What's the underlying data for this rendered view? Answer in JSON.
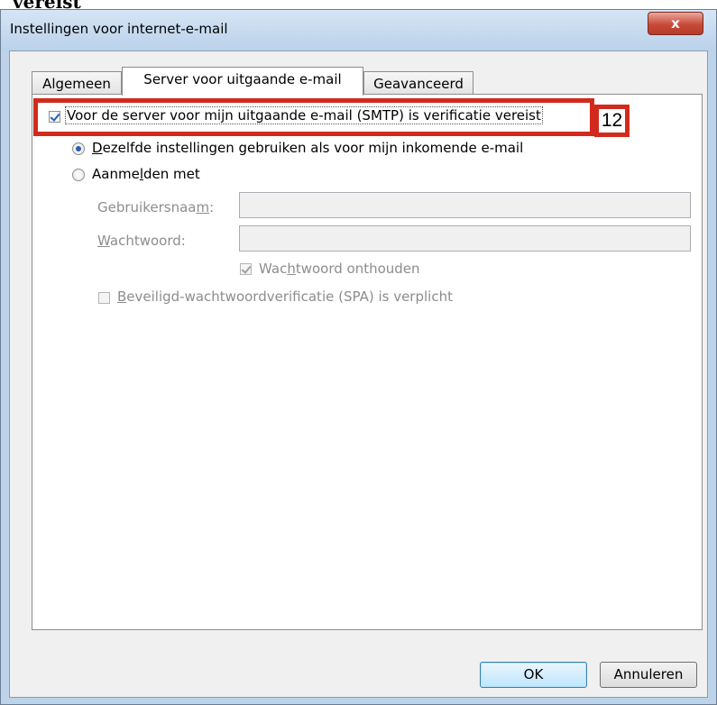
{
  "top_cut_text": "vereist\"",
  "window": {
    "title": "Instellingen voor internet-e-mail",
    "close_label": "x"
  },
  "tabs": [
    {
      "label": "Algemeen",
      "active": false
    },
    {
      "label": "Server voor uitgaande e-mail",
      "active": true
    },
    {
      "label": "Geavanceerd",
      "active": false
    }
  ],
  "smtp": {
    "label": "Voor de server voor mijn uitgaande e-mail (SMTP) is verificatie vereist",
    "checked": true,
    "annotation": "12"
  },
  "radio_same": {
    "pre": "",
    "accel": "D",
    "post": "ezelfde instellingen gebruiken als voor mijn inkomende e-mail",
    "checked": true
  },
  "radio_login": {
    "pre": "Aanme",
    "accel": "l",
    "post": "den met",
    "checked": false
  },
  "username": {
    "pre": "Gebruikersnaa",
    "accel": "m",
    "post": ":",
    "value": ""
  },
  "password": {
    "pre": "",
    "accel": "W",
    "post": "achtwoord:",
    "value": ""
  },
  "remember": {
    "pre": "Wac",
    "accel": "h",
    "post": "twoord onthouden",
    "checked": true
  },
  "spa": {
    "pre": "",
    "accel": "B",
    "post": "eveiligd-wachtwoordverificatie (SPA) is verplicht",
    "checked": false
  },
  "buttons": {
    "ok": "OK",
    "cancel": "Annuleren"
  }
}
